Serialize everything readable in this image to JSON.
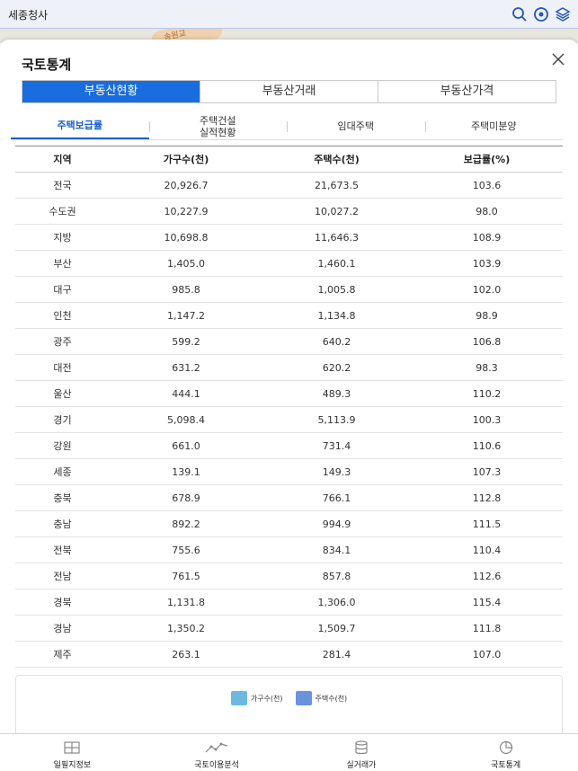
{
  "topbar": {
    "title": "세종청사"
  },
  "map": {
    "road_label": "송원교"
  },
  "panel": {
    "title": "국토통계"
  },
  "segments": [
    {
      "label": "부동산현황",
      "active": true
    },
    {
      "label": "부동산거래",
      "active": false
    },
    {
      "label": "부동산가격",
      "active": false
    }
  ],
  "subtabs": [
    {
      "label": "주택보급률",
      "active": true
    },
    {
      "label": "주택건설\n실적현황",
      "active": false
    },
    {
      "label": "임대주택",
      "active": false
    },
    {
      "label": "주택미분양",
      "active": false
    }
  ],
  "table": {
    "headers": [
      "지역",
      "가구수(천)",
      "주택수(천)",
      "보급률(%)"
    ],
    "rows": [
      [
        "전국",
        "20,926.7",
        "21,673.5",
        "103.6"
      ],
      [
        "수도권",
        "10,227.9",
        "10,027.2",
        "98.0"
      ],
      [
        "지방",
        "10,698.8",
        "11,646.3",
        "108.9"
      ],
      [
        "부산",
        "1,405.0",
        "1,460.1",
        "103.9"
      ],
      [
        "대구",
        "985.8",
        "1,005.8",
        "102.0"
      ],
      [
        "인천",
        "1,147.2",
        "1,134.8",
        "98.9"
      ],
      [
        "광주",
        "599.2",
        "640.2",
        "106.8"
      ],
      [
        "대전",
        "631.2",
        "620.2",
        "98.3"
      ],
      [
        "울산",
        "444.1",
        "489.3",
        "110.2"
      ],
      [
        "경기",
        "5,098.4",
        "5,113.9",
        "100.3"
      ],
      [
        "강원",
        "661.0",
        "731.4",
        "110.6"
      ],
      [
        "세종",
        "139.1",
        "149.3",
        "107.3"
      ],
      [
        "충북",
        "678.9",
        "766.1",
        "112.8"
      ],
      [
        "충남",
        "892.2",
        "994.9",
        "111.5"
      ],
      [
        "전북",
        "755.6",
        "834.1",
        "110.4"
      ],
      [
        "전남",
        "761.5",
        "857.8",
        "112.6"
      ],
      [
        "경북",
        "1,131.8",
        "1,306.0",
        "115.4"
      ],
      [
        "경남",
        "1,350.2",
        "1,509.7",
        "111.8"
      ],
      [
        "제주",
        "263.1",
        "281.4",
        "107.0"
      ]
    ]
  },
  "chart": {
    "legend": [
      {
        "label": "가구수(천)",
        "color": "#6cb9e0"
      },
      {
        "label": "주택수(천)",
        "color": "#6a93dc"
      }
    ]
  },
  "bottom_nav": [
    {
      "label": "일필지정보",
      "icon": "map-grid-icon"
    },
    {
      "label": "국토이용분석",
      "icon": "line-graph-icon"
    },
    {
      "label": "실거래가",
      "icon": "database-icon"
    },
    {
      "label": "국토통계",
      "icon": "pie-chart-icon"
    }
  ],
  "colors": {
    "accent": "#1a6ddf",
    "tab_active": "#1a5fcf"
  }
}
